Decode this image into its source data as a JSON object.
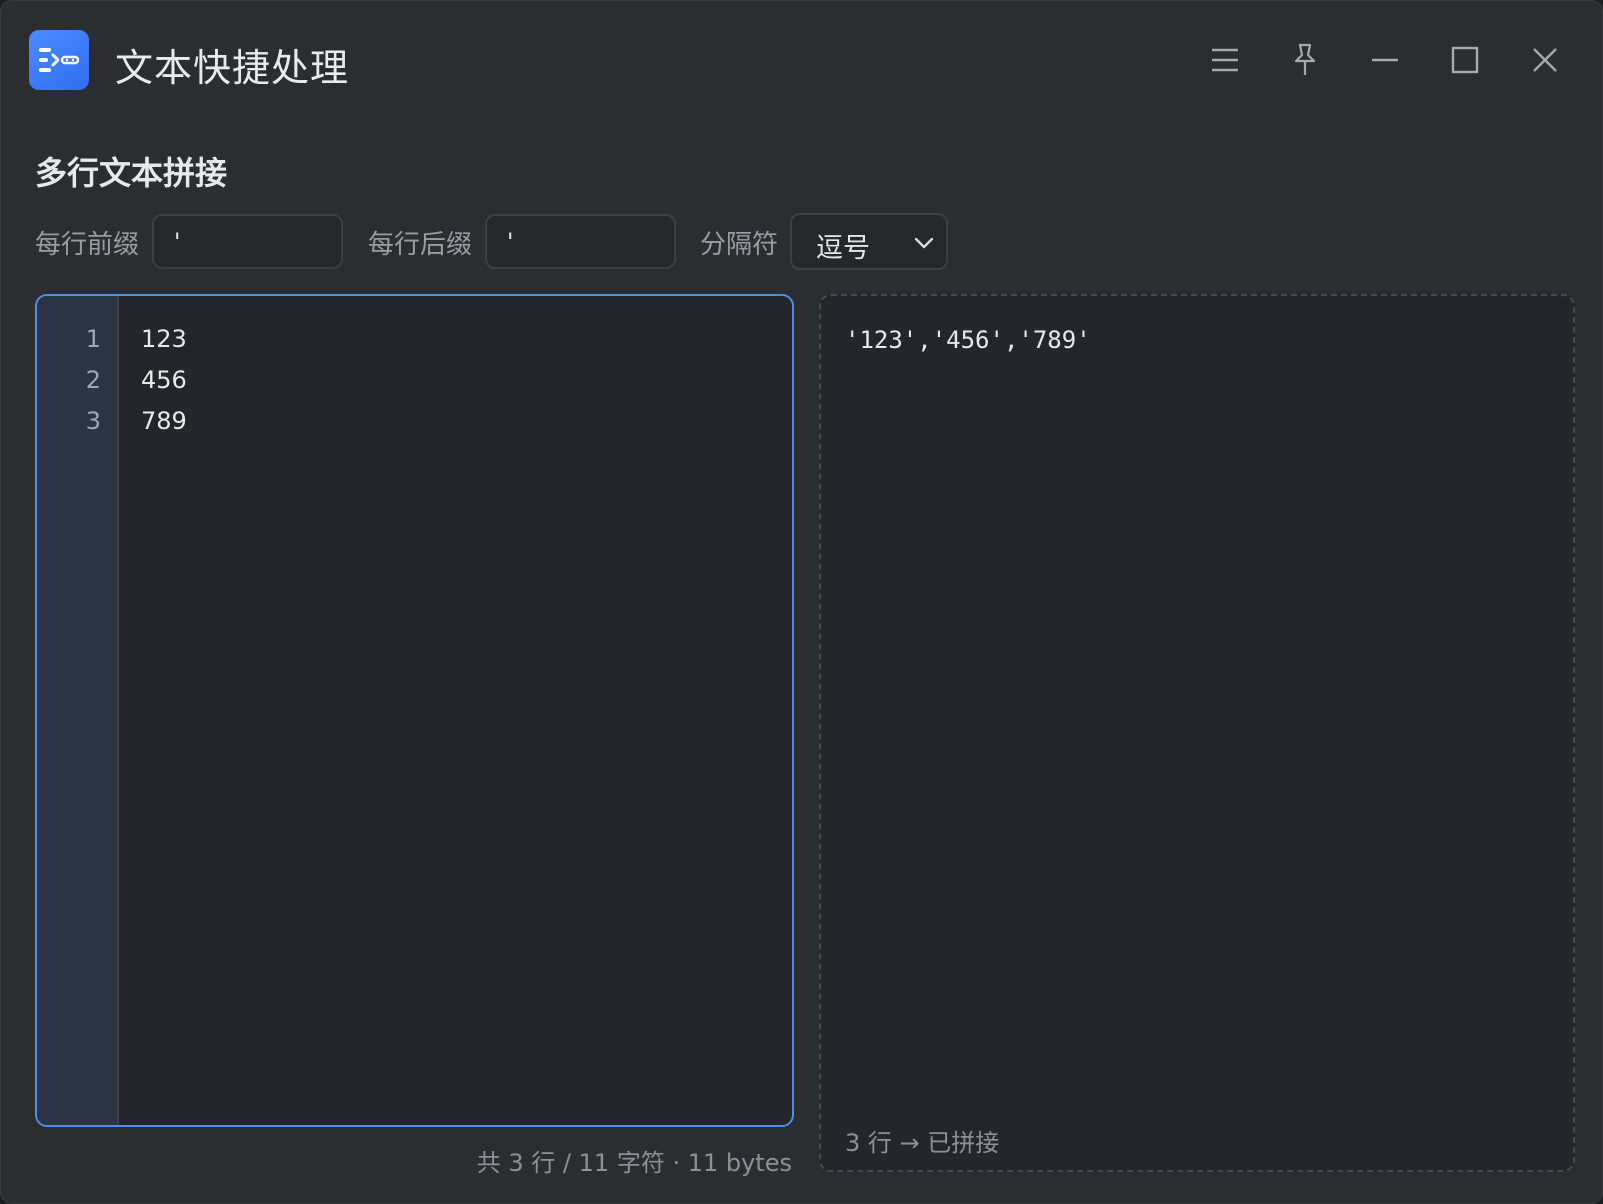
{
  "app": {
    "title": "文本快捷处理",
    "icon": "text-join-app-icon"
  },
  "window_controls": {
    "menu_icon": "hamburger-menu-icon",
    "pin_icon": "pin-icon",
    "minimize_icon": "minimize-icon",
    "maximize_icon": "maximize-icon",
    "close_icon": "close-icon"
  },
  "section": {
    "title": "多行文本拼接"
  },
  "controls": {
    "prefix_label": "每行前缀",
    "prefix_value": "'",
    "suffix_label": "每行后缀",
    "suffix_value": "'",
    "separator_label": "分隔符",
    "separator_value": "逗号"
  },
  "editor": {
    "lines": [
      {
        "no": "1",
        "text": "123"
      },
      {
        "no": "2",
        "text": "456"
      },
      {
        "no": "3",
        "text": "789"
      }
    ],
    "stats": "共 3 行 / 11 字符 · 11 bytes"
  },
  "output": {
    "text": "'123','456','789'",
    "status": "3 行 → 已拼接"
  },
  "colors": {
    "accent": "#4b8fe6",
    "background": "#2c2d31",
    "panel": "#25262b"
  }
}
